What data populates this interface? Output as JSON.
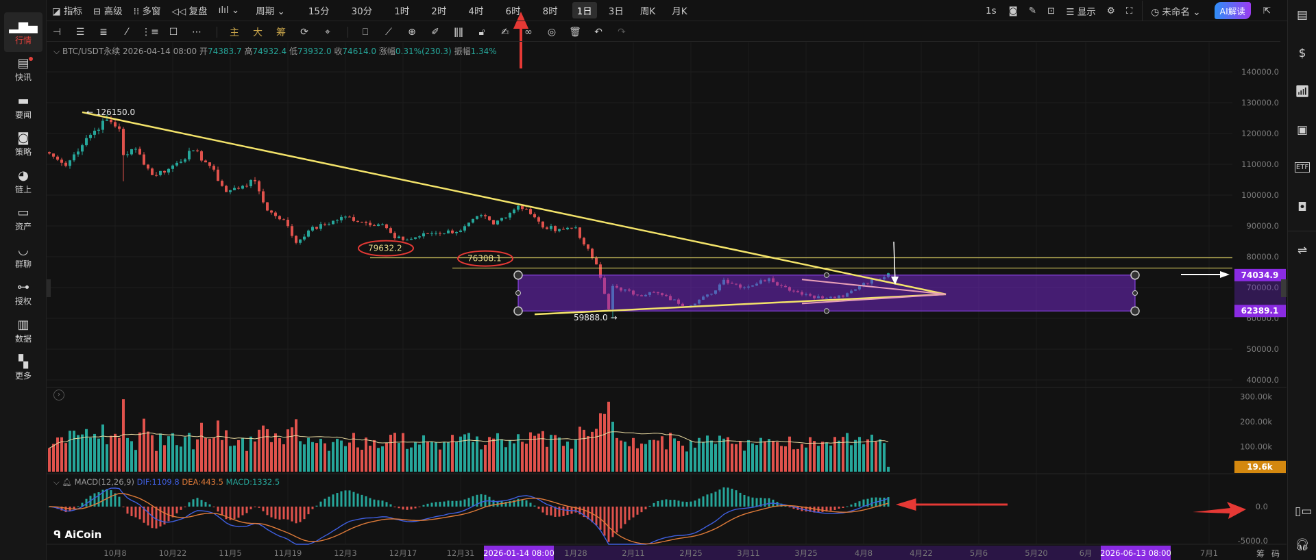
{
  "left_nav": [
    {
      "label": "行情",
      "icon": "bar-chart-icon",
      "active": true
    },
    {
      "label": "快讯",
      "icon": "news-flash-icon",
      "badge": true
    },
    {
      "label": "要闻",
      "icon": "document-icon"
    },
    {
      "label": "策略",
      "icon": "robot-icon"
    },
    {
      "label": "链上",
      "icon": "chain-icon"
    },
    {
      "label": "资产",
      "icon": "wallet-icon"
    },
    {
      "label": "群聊",
      "icon": "chat-icon"
    },
    {
      "label": "授权",
      "icon": "key-icon"
    },
    {
      "label": "数据",
      "icon": "data-monitor-icon"
    },
    {
      "label": "更多",
      "icon": "grid-more-icon"
    }
  ],
  "toolbar": {
    "indicators": "指标",
    "advanced": "高级",
    "multi_window": "多窗",
    "replay": "复盘",
    "period": "周期",
    "timeframes": [
      "15分",
      "30分",
      "1时",
      "2时",
      "4时",
      "6时",
      "8时",
      "1日",
      "3日",
      "周K",
      "月K"
    ],
    "selected_timeframe": "1日",
    "refresh": "1s",
    "display": "显示",
    "layout_name": "未命名",
    "ai_button": "AI解读",
    "drawing_tools": [
      "horizontal-line",
      "parallel-lines",
      "fib-lines",
      "trend-line",
      "channel",
      "rectangle",
      "more"
    ],
    "overlays": [
      "主",
      "大",
      "筹"
    ]
  },
  "info": {
    "symbol": "BTC/USDT永续",
    "datetime": "2026-04-14 08:00",
    "open_label": "开",
    "open": "74383.7",
    "high_label": "高",
    "high": "74932.4",
    "low_label": "低",
    "low": "73932.0",
    "close_label": "收",
    "close": "74614.0",
    "change_label": "涨幅",
    "change": "0.31%(230.3)",
    "amp_label": "振幅",
    "amp": "1.34%"
  },
  "macd_info": {
    "name": "MACD(12,26,9)",
    "dif": "DIF:1109.8",
    "dea": "DEA:443.5",
    "macd": "MACD:1332.5"
  },
  "colors": {
    "up": "#26a69a",
    "down": "#e0524c",
    "accent": "#8a2be2",
    "trend": "#f3e36a",
    "dif": "#3f5fe0",
    "dea": "#e07b39",
    "volume_tag": "#d4880f",
    "annotation": "#e53935"
  },
  "brand": "AiCoin",
  "chart_data": {
    "type": "candlestick",
    "symbol": "BTC/USDT永续",
    "price_axis": {
      "ticks": [
        "140000.0",
        "130000.0",
        "120000.0",
        "110000.0",
        "100000.0",
        "90000.0",
        "80000.0",
        "70000.0",
        "60000.0",
        "50000.0",
        "40000.0"
      ],
      "range": [
        40000,
        140000
      ]
    },
    "volume_axis": {
      "ticks": [
        "300.00k",
        "200.00k",
        "100.00k"
      ],
      "current": "19.6k"
    },
    "macd_axis": {
      "ticks": [
        "0.0",
        "-5000.0"
      ]
    },
    "x_axis": {
      "ticks": [
        {
          "date": "2025-10-08",
          "label": "10月8"
        },
        {
          "date": "2025-10-22",
          "label": "10月22"
        },
        {
          "date": "2025-11-05",
          "label": "11月5"
        },
        {
          "date": "2025-11-19",
          "label": "11月19"
        },
        {
          "date": "2025-12-03",
          "label": "12月3"
        },
        {
          "date": "2025-12-17",
          "label": "12月17"
        },
        {
          "date": "2025-12-31",
          "label": "12月31"
        },
        {
          "date": "2026-01-28",
          "label": "1月28"
        },
        {
          "date": "2026-02-11",
          "label": "2月11"
        },
        {
          "date": "2026-02-25",
          "label": "2月25"
        },
        {
          "date": "2026-03-11",
          "label": "3月11"
        },
        {
          "date": "2026-03-25",
          "label": "3月25"
        },
        {
          "date": "2026-04-08",
          "label": "4月8"
        },
        {
          "date": "2026-04-22",
          "label": "4月22"
        },
        {
          "date": "2026-05-06",
          "label": "5月6"
        },
        {
          "date": "2026-05-20",
          "label": "5月20"
        },
        {
          "date": "2026-06-01",
          "label": "6月"
        },
        {
          "date": "2026-07-01",
          "label": "7月1"
        }
      ],
      "range_start": {
        "date": "2026-01-14",
        "label": "2026-01-14 08:00"
      },
      "range_end": {
        "date": "2026-06-13",
        "label": "2026-06-13 08:00"
      },
      "chip_labels": [
        "筹",
        "码"
      ]
    },
    "close_path": [
      [
        "2025-09-22",
        113500
      ],
      [
        "2025-09-26",
        109500
      ],
      [
        "2025-10-01",
        118500
      ],
      [
        "2025-10-06",
        124500
      ],
      [
        "2025-10-09",
        121500
      ],
      [
        "2025-10-10",
        113000
      ],
      [
        "2025-10-13",
        115000
      ],
      [
        "2025-10-17",
        106500
      ],
      [
        "2025-10-21",
        108500
      ],
      [
        "2025-10-27",
        114500
      ],
      [
        "2025-10-31",
        109500
      ],
      [
        "2025-11-04",
        101000
      ],
      [
        "2025-11-08",
        103000
      ],
      [
        "2025-11-11",
        104500
      ],
      [
        "2025-11-14",
        95000
      ],
      [
        "2025-11-18",
        92000
      ],
      [
        "2025-11-21",
        84500
      ],
      [
        "2025-11-24",
        88500
      ],
      [
        "2025-12-03",
        93000
      ],
      [
        "2025-12-08",
        91000
      ],
      [
        "2025-12-12",
        90500
      ],
      [
        "2025-12-15",
        86000
      ],
      [
        "2025-12-18",
        85500
      ],
      [
        "2025-12-23",
        87500
      ],
      [
        "2025-12-31",
        88500
      ],
      [
        "2026-01-05",
        93500
      ],
      [
        "2026-01-08",
        90500
      ],
      [
        "2026-01-14",
        96500
      ],
      [
        "2026-01-16",
        95500
      ],
      [
        "2026-01-20",
        89500
      ],
      [
        "2026-01-24",
        89000
      ],
      [
        "2026-01-28",
        89500
      ],
      [
        "2026-01-30",
        84000
      ],
      [
        "2026-02-02",
        77500
      ],
      [
        "2026-02-05",
        63000
      ],
      [
        "2026-02-06",
        70500
      ],
      [
        "2026-02-12",
        67500
      ],
      [
        "2026-02-16",
        68500
      ],
      [
        "2026-02-24",
        64000
      ],
      [
        "2026-03-02",
        68000
      ],
      [
        "2026-03-05",
        72500
      ],
      [
        "2026-03-10",
        70000
      ],
      [
        "2026-03-16",
        73000
      ],
      [
        "2026-03-19",
        70500
      ],
      [
        "2026-03-23",
        68500
      ],
      [
        "2026-03-29",
        66500
      ],
      [
        "2026-04-03",
        67000
      ],
      [
        "2026-04-08",
        71500
      ],
      [
        "2026-04-11",
        72500
      ],
      [
        "2026-04-14",
        74614
      ]
    ],
    "extremes": [
      {
        "date": "2025-10-06",
        "high": 126150,
        "label": "126150.0"
      },
      {
        "date": "2026-02-06",
        "low": 59888,
        "label": "59888.0"
      },
      {
        "date": "2025-10-10",
        "low": 104500
      }
    ],
    "volume_spikes": [
      [
        "2025-10-10",
        290000
      ],
      [
        "2025-11-21",
        210000
      ],
      [
        "2025-11-14",
        170000
      ],
      [
        "2026-02-05",
        280000
      ],
      [
        "2026-02-06",
        200000
      ],
      [
        "2026-01-14",
        150000
      ]
    ],
    "drawings": {
      "trend_line": [
        [
          "2025-09-30",
          126900
        ],
        [
          "2026-04-28",
          67800
        ]
      ],
      "support_line": [
        [
          "2026-01-18",
          61300
        ],
        [
          "2026-04-28",
          67800
        ]
      ],
      "horizontal_lines": [
        {
          "price": 79632.2,
          "from": "2025-12-09",
          "label": "79632.2"
        },
        {
          "price": 76308.1,
          "from": "2025-12-29",
          "label": "76308.1"
        }
      ],
      "rectangle": {
        "from": "2026-01-14",
        "to": "2026-06-13",
        "top": 74034.9,
        "bottom": 62389.1,
        "top_label": "74034.9",
        "bottom_label": "62389.1"
      }
    }
  }
}
